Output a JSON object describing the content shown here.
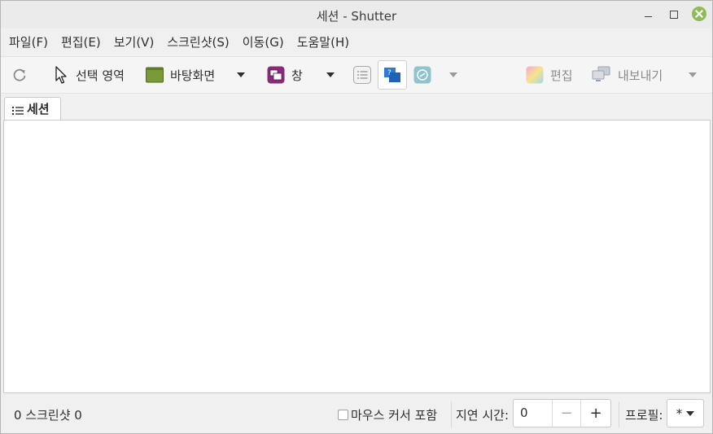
{
  "window": {
    "title": "세션 - Shutter"
  },
  "menubar": {
    "items": [
      "파일(F)",
      "편집(E)",
      "보기(V)",
      "스크린샷(S)",
      "이동(G)",
      "도움말(H)"
    ]
  },
  "toolbar": {
    "selection_label": "선택 영역",
    "desktop_label": "바탕화면",
    "window_label": "창",
    "edit_label": "편집",
    "export_label": "내보내기"
  },
  "tabs": {
    "session_label": "세션"
  },
  "statusbar": {
    "screenshot_count": "0 스크린샷  0",
    "include_cursor_label": "마우스 커서 포함",
    "include_cursor_checked": false,
    "delay_label": "지연 시간:",
    "delay_value": "0",
    "minus": "−",
    "plus": "+",
    "profile_label": "프로필:",
    "profile_value": "*"
  },
  "colors": {
    "close_button": "#8fba5a",
    "desktop_icon": "#7a9a3a",
    "window_icon": "#8a2a7a",
    "help_icon": "#2e7bd6"
  }
}
